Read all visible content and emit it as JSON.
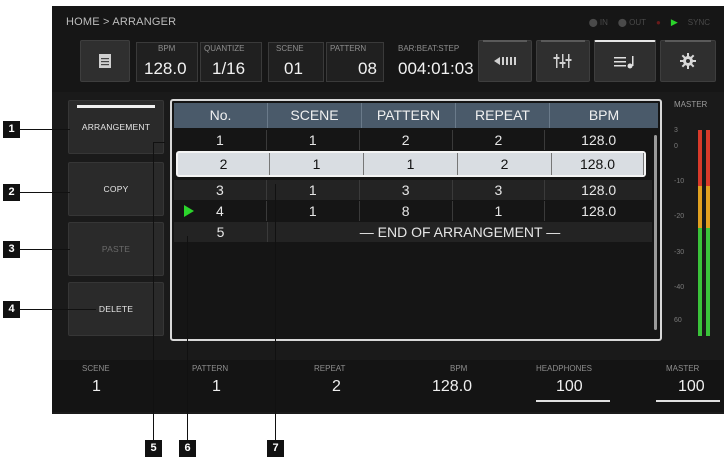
{
  "header": {
    "breadcrumb": "HOME > ARRANGER",
    "status": {
      "in": "IN",
      "out": "OUT",
      "sync": "SYNC"
    },
    "params": {
      "bpm_label": "BPM",
      "bpm_value": "128.0",
      "quantize_label": "QUANTIZE",
      "quantize_value": "1/16",
      "scene_label": "SCENE",
      "scene_value": "01",
      "pattern_label": "PATTERN",
      "pattern_value": "08",
      "barbeat_label": "BAR:BEAT:STEP",
      "barbeat_value": "004:01:03"
    }
  },
  "sidebar": {
    "arrangement": "ARRANGEMENT",
    "copy": "COPY",
    "paste": "PASTE",
    "delete": "DELETE"
  },
  "table": {
    "columns": [
      "No.",
      "SCENE",
      "PATTERN",
      "REPEAT",
      "BPM"
    ],
    "rows": [
      [
        "1",
        "1",
        "2",
        "2",
        "128.0"
      ],
      [
        "2",
        "1",
        "1",
        "2",
        "128.0"
      ],
      [
        "3",
        "1",
        "3",
        "3",
        "128.0"
      ],
      [
        "4",
        "1",
        "8",
        "1",
        "128.0"
      ]
    ],
    "end_no": "5",
    "end_text": "— END OF ARRANGEMENT —",
    "selected_row": 2,
    "playing_row": 4
  },
  "meter": {
    "label": "MASTER",
    "scale": [
      "3",
      "0",
      "-10",
      "-20",
      "-30",
      "-40",
      "60"
    ]
  },
  "bottom": {
    "scene_label": "SCENE",
    "scene_value": "1",
    "pattern_label": "PATTERN",
    "pattern_value": "1",
    "repeat_label": "REPEAT",
    "repeat_value": "2",
    "bpm_label": "BPM",
    "bpm_value": "128.0",
    "headphones_label": "HEADPHONES",
    "headphones_value": "100",
    "master_label": "MASTER",
    "master_value": "100"
  },
  "callouts": [
    "1",
    "2",
    "3",
    "4",
    "5",
    "6",
    "7"
  ],
  "colors": {
    "accent_green": "#2bd42b",
    "header_blue": "#4a5a6a",
    "selection": "#d9dde2"
  }
}
